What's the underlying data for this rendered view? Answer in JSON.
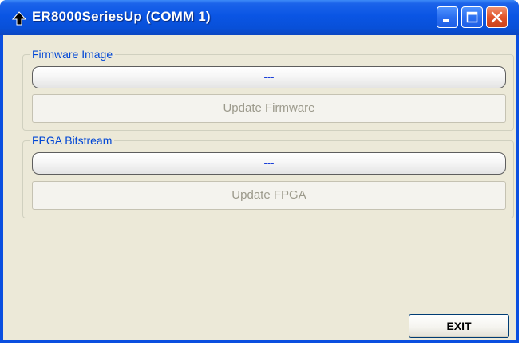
{
  "window": {
    "title": "ER8000SeriesUp (COMM 1)",
    "icon": "up-arrow-icon",
    "controls": [
      "minimize-icon",
      "maximize-icon",
      "close-icon"
    ]
  },
  "firmware": {
    "group_label": "Firmware Image",
    "status": "---",
    "button_label": "Update Firmware"
  },
  "fpga": {
    "group_label": "FPGA Bitstream",
    "status": "---",
    "button_label": "Update FPGA"
  },
  "footer": {
    "exit_label": "EXIT"
  },
  "colors": {
    "titlebar": "#0a55e4",
    "client_bg": "#ece9d8",
    "group_label": "#0046d5",
    "status_text": "#1a3fd8",
    "disabled_text": "#9c9a8c",
    "close_button": "#e0532a"
  }
}
